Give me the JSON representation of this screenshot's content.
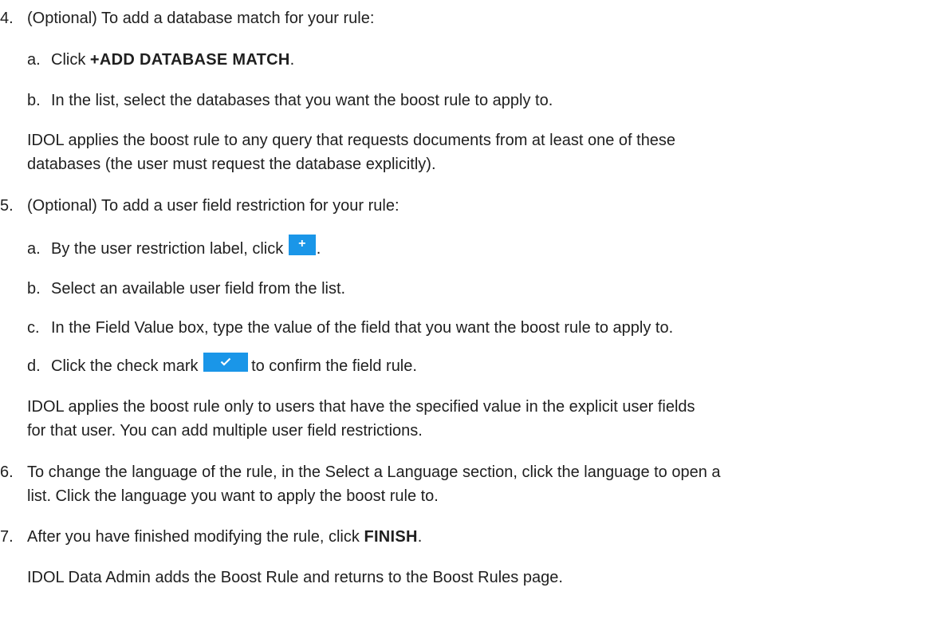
{
  "steps": {
    "step4": {
      "num": "4.",
      "text": "(Optional) To add a database match for your rule:",
      "sub_a": {
        "letter": "a.",
        "pre": "Click ",
        "bold": "+ADD DATABASE MATCH",
        "post": "."
      },
      "sub_b": {
        "letter": "b.",
        "text": "In the list, select the databases that you want the boost rule to apply to."
      },
      "note": [
        "IDOL applies the boost rule to any query that requests documents from at least one of these",
        "databases (the user must request the database explicitly)."
      ]
    },
    "step5": {
      "num": "5.",
      "text": "(Optional) To add a user field restriction for your rule:",
      "sub_a": {
        "letter": "a.",
        "pre": "By the user restriction label, click ",
        "icon": "+",
        "post": "."
      },
      "sub_b": {
        "letter": "b.",
        "text": "Select an available user field from the list."
      },
      "sub_c": {
        "letter": "c.",
        "text": "In the Field Value box, type the value of the field that you want the boost rule to apply to."
      },
      "sub_d": {
        "letter": "d.",
        "pre": "Click the check mark ",
        "icon": "check-icon",
        "post": "to confirm the field rule."
      },
      "note": [
        "IDOL applies the boost rule only to users that have the specified value in the explicit user fields",
        "for that user. You can add multiple user field restrictions."
      ]
    },
    "step6": {
      "num": "6.",
      "lines": [
        "To change the language of the rule, in the Select a Language section, click the language to open a",
        "list. Click the language you want to apply the boost rule to."
      ]
    },
    "step7": {
      "num": "7.",
      "pre": "After you have finished modifying the rule, click ",
      "bold": "FINISH",
      "post": ".",
      "note": "IDOL Data Admin adds the Boost Rule and returns to the Boost Rules page."
    }
  },
  "colors": {
    "text": "#1f1f1f",
    "button": "#1a96e8"
  }
}
